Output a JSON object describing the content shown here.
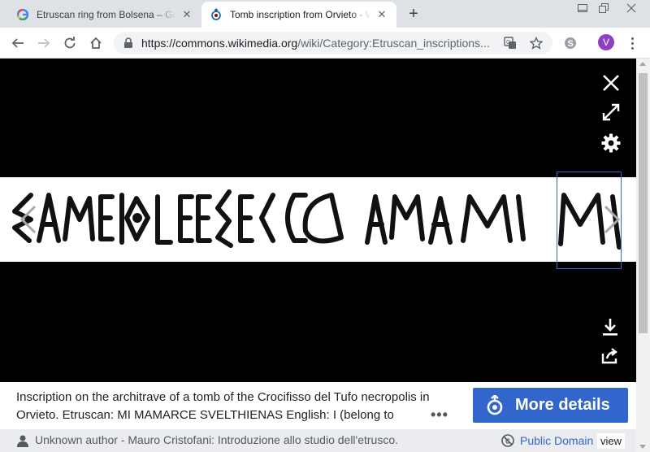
{
  "browser": {
    "tabs": [
      {
        "title": "Etruscan ring from Bolsena – Google Search",
        "favicon": "google-icon"
      },
      {
        "title": "Tomb inscription from Orvieto - Wikimedia Commons",
        "favicon": "wikimedia-icon"
      }
    ],
    "url_host": "https://commons.wikimedia.org",
    "url_path": "/wiki/Category:Etruscan_inscriptions...",
    "profile_initial": "V"
  },
  "viewer": {
    "caption": "Inscription on the architrave of a tomb of the Crocifisso del Tufo necropolis in Orvieto. Etruscan: MI MAMARCE SVELTHIENAS English: I (belong to",
    "more_label": "More details",
    "author_credit": "Unknown author - Mauro Cristofani: Introduzione allo studio dell'etrusco.",
    "license_label": "Public Domain",
    "view_label": "view"
  },
  "colors": {
    "accent": "#3366cc",
    "tabstrip": "#dee1e6",
    "credit_bg": "#eaecf0"
  }
}
